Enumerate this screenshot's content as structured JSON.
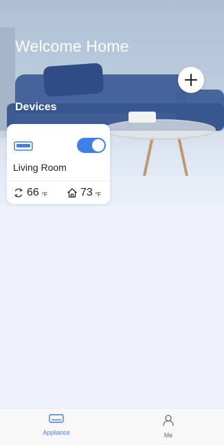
{
  "header": {
    "title": "Welcome Home",
    "add_icon": "plus-icon"
  },
  "devices": {
    "section_label": "Devices",
    "items": [
      {
        "icon": "air-conditioner-icon",
        "name": "Living Room",
        "power_on": true,
        "mode_icon": "cycle-icon",
        "set_temperature": "66",
        "set_temperature_unit": "°F",
        "home_icon": "home-icon",
        "indoor_temperature": "73",
        "indoor_temperature_unit": "°F"
      }
    ]
  },
  "tabbar": {
    "tabs": [
      {
        "label": "Appliance",
        "icon": "appliance-icon",
        "active": true
      },
      {
        "label": "Me",
        "icon": "person-icon",
        "active": false
      }
    ]
  },
  "colors": {
    "accent": "#3f7fe6",
    "title_text": "#ffffff"
  }
}
